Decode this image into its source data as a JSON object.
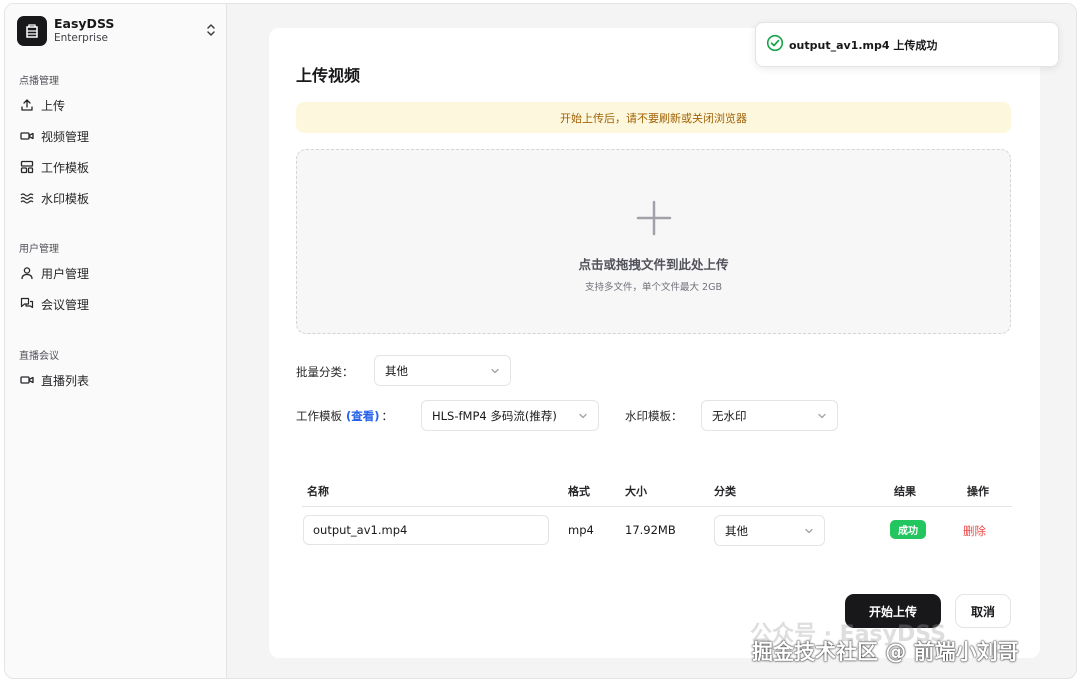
{
  "brand": {
    "name": "EasyDSS",
    "edition": "Enterprise"
  },
  "sidebar": {
    "groups": [
      {
        "label": "点播管理",
        "items": [
          {
            "label": "上传",
            "icon": "upload-icon"
          },
          {
            "label": "视频管理",
            "icon": "video-icon"
          },
          {
            "label": "工作模板",
            "icon": "layout-template-icon"
          },
          {
            "label": "水印模板",
            "icon": "waves-icon"
          }
        ]
      },
      {
        "label": "用户管理",
        "items": [
          {
            "label": "用户管理",
            "icon": "user-icon"
          },
          {
            "label": "会议管理",
            "icon": "messages-icon"
          }
        ]
      },
      {
        "label": "直播会议",
        "items": [
          {
            "label": "直播列表",
            "icon": "video-icon"
          }
        ]
      }
    ]
  },
  "page": {
    "title": "上传视频",
    "alert": "开始上传后，请不要刷新或关闭浏览器"
  },
  "dropzone": {
    "title": "点击或拖拽文件到此处上传",
    "hint": "支持多文件，单个文件最大 2GB"
  },
  "form": {
    "batch_category_label": "批量分类：",
    "batch_category_value": "其他",
    "work_template_label": "工作模板",
    "work_template_link": "(查看)",
    "work_template_colon": "：",
    "work_template_value": "HLS-fMP4 多码流(推荐)",
    "watermark_label": "水印模板：",
    "watermark_value": "无水印"
  },
  "table": {
    "headers": [
      "名称",
      "格式",
      "大小",
      "分类",
      "结果",
      "操作"
    ],
    "rows": [
      {
        "name": "output_av1.mp4",
        "format": "mp4",
        "size": "17.92MB",
        "category": "其他",
        "result": "成功",
        "action": "删除"
      }
    ]
  },
  "actions": {
    "start": "开始上传",
    "cancel": "取消"
  },
  "toast": {
    "message": "output_av1.mp4 上传成功"
  },
  "watermark": {
    "faint": "公众号 · EasyDSS",
    "text": "掘金技术社区 @ 前端小刘哥"
  },
  "colors": {
    "primary": "#18181b",
    "success": "#22c55e",
    "danger": "#ef4444",
    "link": "#2563eb",
    "alert_bg": "#fdf8dd",
    "alert_text": "#a16207"
  }
}
